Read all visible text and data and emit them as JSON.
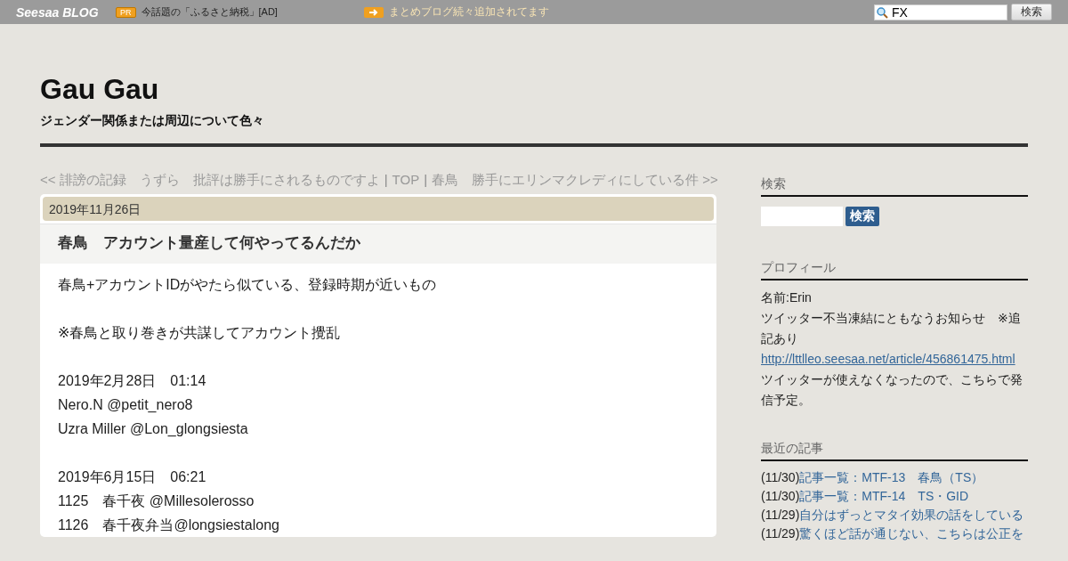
{
  "topbar": {
    "logo": {
      "brand": "Seesaa",
      "suffix": "BLOG"
    },
    "pr_badge": "PR",
    "ad_text": "今話題の「ふるさと納税」[AD]",
    "notice": "まとめブログ続々追加されてます",
    "search": {
      "value": "FX"
    },
    "search_button": "検索"
  },
  "blog": {
    "title": "Gau Gau",
    "subtitle": "ジェンダー関係または周辺について色々"
  },
  "nav": [
    {
      "kind": "link",
      "text": "<< 誹謗の記録　うずら　批評は勝手にされるものですよ"
    },
    {
      "kind": "sep",
      "text": "|"
    },
    {
      "kind": "link",
      "text": "TOP"
    },
    {
      "kind": "sep",
      "text": "|"
    },
    {
      "kind": "link",
      "text": "春鳥　勝手にエリンマクレディにしている件 >>"
    }
  ],
  "post": {
    "date": "2019年11月26日",
    "title": "春鳥　アカウント量産して何やってるんだか",
    "paragraphs": [
      [
        "春鳥+アカウントIDがやたら似ている、登録時期が近いもの"
      ],
      [
        "※春鳥と取り巻きが共謀してアカウント攪乱"
      ],
      [
        "2019年2月28日　01:14",
        "Nero.N @petit_nero8",
        "Uzra Miller @Lon_glongsiesta"
      ],
      [
        "2019年6月15日　06:21",
        "1125　春千夜 @Millesolerosso",
        "1126　春千夜弁当@longsiestalong"
      ]
    ]
  },
  "sidebar": {
    "search": {
      "heading": "検索",
      "button": "検索"
    },
    "profile": {
      "heading": "プロフィール",
      "lines": [
        {
          "kind": "text",
          "text": "名前:Erin"
        },
        {
          "kind": "text",
          "text": "ツイッター不当凍結にともなうお知らせ　※追記あり"
        },
        {
          "kind": "link",
          "text": "http://lttlleo.seesaa.net/article/456861475.html"
        },
        {
          "kind": "text",
          "text": "ツイッターが使えなくなったので、こちらで発信予定。"
        }
      ]
    },
    "recent": {
      "heading": "最近の記事",
      "items": [
        {
          "date": "(11/30)",
          "title": "記事一覧：MTF-13　春鳥（TS）"
        },
        {
          "date": "(11/30)",
          "title": "記事一覧：MTF-14　TS・GID"
        },
        {
          "date": "(11/29)",
          "title": "自分はずっとマタイ効果の話をしている"
        },
        {
          "date": "(11/29)",
          "title": "驚くほど話が通じない、こちらは公正を"
        }
      ]
    }
  }
}
